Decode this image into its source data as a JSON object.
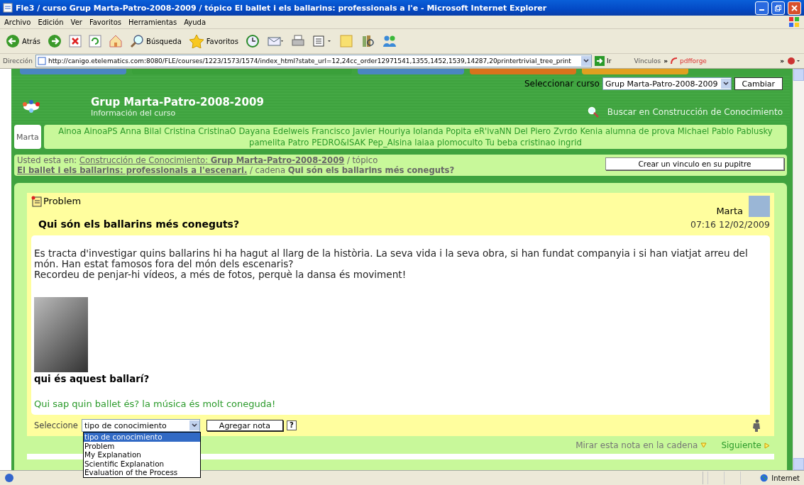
{
  "window": {
    "title": "Fle3 / curso Grup Marta-Patro-2008-2009 / tópico El ballet i els ballarins: professionals a l'e - Microsoft Internet Explorer"
  },
  "menu": [
    "Archivo",
    "Edición",
    "Ver",
    "Favoritos",
    "Herramientas",
    "Ayuda"
  ],
  "toolbar": [
    {
      "kind": "back",
      "label": "Atrás"
    },
    {
      "kind": "forward"
    },
    {
      "kind": "stop"
    },
    {
      "kind": "refresh"
    },
    {
      "kind": "home"
    },
    {
      "kind": "search",
      "label": "Búsqueda"
    },
    {
      "kind": "favorites",
      "label": "Favoritos"
    },
    {
      "kind": "history"
    },
    {
      "kind": "mail"
    },
    {
      "kind": "print"
    },
    {
      "kind": "edit"
    },
    {
      "kind": "note"
    },
    {
      "kind": "research"
    },
    {
      "kind": "messenger"
    }
  ],
  "address_bar": {
    "label": "Dirección",
    "url": "http://canigo.etelematics.com:8080/FLE/courses/1223/1573/1574/index_html?state_url=12,24cc_order12971541,1355,1452,1539,14287,20printertrivial_tree_print",
    "go": "Ir",
    "links_label": "Vínculos",
    "links_more": "»",
    "pdf_link": "pdfforge",
    "more": "»"
  },
  "site_tabs": [
    {
      "color": "#4a86c0",
      "selected": false
    },
    {
      "color": "#3aa03a",
      "selected": true
    },
    {
      "color": "#4a86c0",
      "selected": false
    },
    {
      "color": "#d8731c",
      "selected": false
    },
    {
      "color": "#e0a020",
      "selected": false
    }
  ],
  "course_select": {
    "label": "Seleccionar curso",
    "value": "Grup Marta-Patro-2008-2009",
    "button": "Cambiar"
  },
  "course": {
    "title": "Grup Marta-Patro-2008-2009",
    "subtitle": "Información del curso",
    "search_link": "Buscar en Construcción de Conocimiento"
  },
  "members": {
    "current": "Marta",
    "others": [
      "Ainoa",
      "AinoaPS",
      "Anna",
      "Bilal",
      "Cristina",
      "CristinaO",
      "Dayana",
      "Edelweis",
      "Francisco Javier",
      "Houriya",
      "Iolanda",
      "Popita",
      "eR'ivaNN",
      "Del Piero",
      "Zvrdo",
      "Kenia",
      "alumna de prova",
      "Michael",
      "Pablo",
      "Pablusky",
      "pamelita",
      "Patro",
      "PEDRO&ISAK",
      "Pep_Alsina",
      "laiaa",
      "plomoculto",
      "Tu beba",
      "cristinao",
      "ingrid"
    ]
  },
  "breadcrumb": {
    "intro": "Usted esta en:",
    "area_link": "Construcción de Conocimiento: **Grup Marta-Patro-2008-2009**",
    "topic_sep": "/ tópico",
    "topic_link": "El ballet i els ballarins: professionals a l'escenari.",
    "thread_sep": "/ cadena",
    "thread": "Qui són els ballarins més coneguts?",
    "button": "Crear un vinculo en su pupitre"
  },
  "note": {
    "type": "Problem",
    "author": "Marta",
    "title": "Qui són els ballarins més coneguts?",
    "time": "07:16 12/02/2009",
    "paragraphs": [
      "Es tracta d'investigar quins ballarins hi ha hagut al llarg de la història. La seva vida i la seva obra, si han fundat companyia i si han viatjat arreu del món. Han estat famosos fora del món dels escenaris?",
      "Recordeu de penjar-hi vídeos, a més de fotos, perquè la dansa és moviment!"
    ],
    "caption": "qui és aquest ballarí?",
    "link": "Qui sap quin ballet és? la música és molt coneguda!"
  },
  "note_actions": {
    "label": "Seleccione",
    "select_value": "tipo de conocimiento",
    "button": "Agregar nota",
    "help": "?",
    "options": [
      {
        "label": "tipo de conocimiento",
        "selected": true
      },
      {
        "label": "Problem",
        "selected": false
      },
      {
        "label": "My Explanation",
        "selected": false
      },
      {
        "label": "Scientific Explanation",
        "selected": false
      },
      {
        "label": "Evaluation of the Process",
        "selected": false
      }
    ]
  },
  "thread_nav": {
    "view_link": "Mirar esta nota en la cadena",
    "next_link": "Siguiente"
  },
  "status_bar": {
    "zone": "Internet"
  }
}
